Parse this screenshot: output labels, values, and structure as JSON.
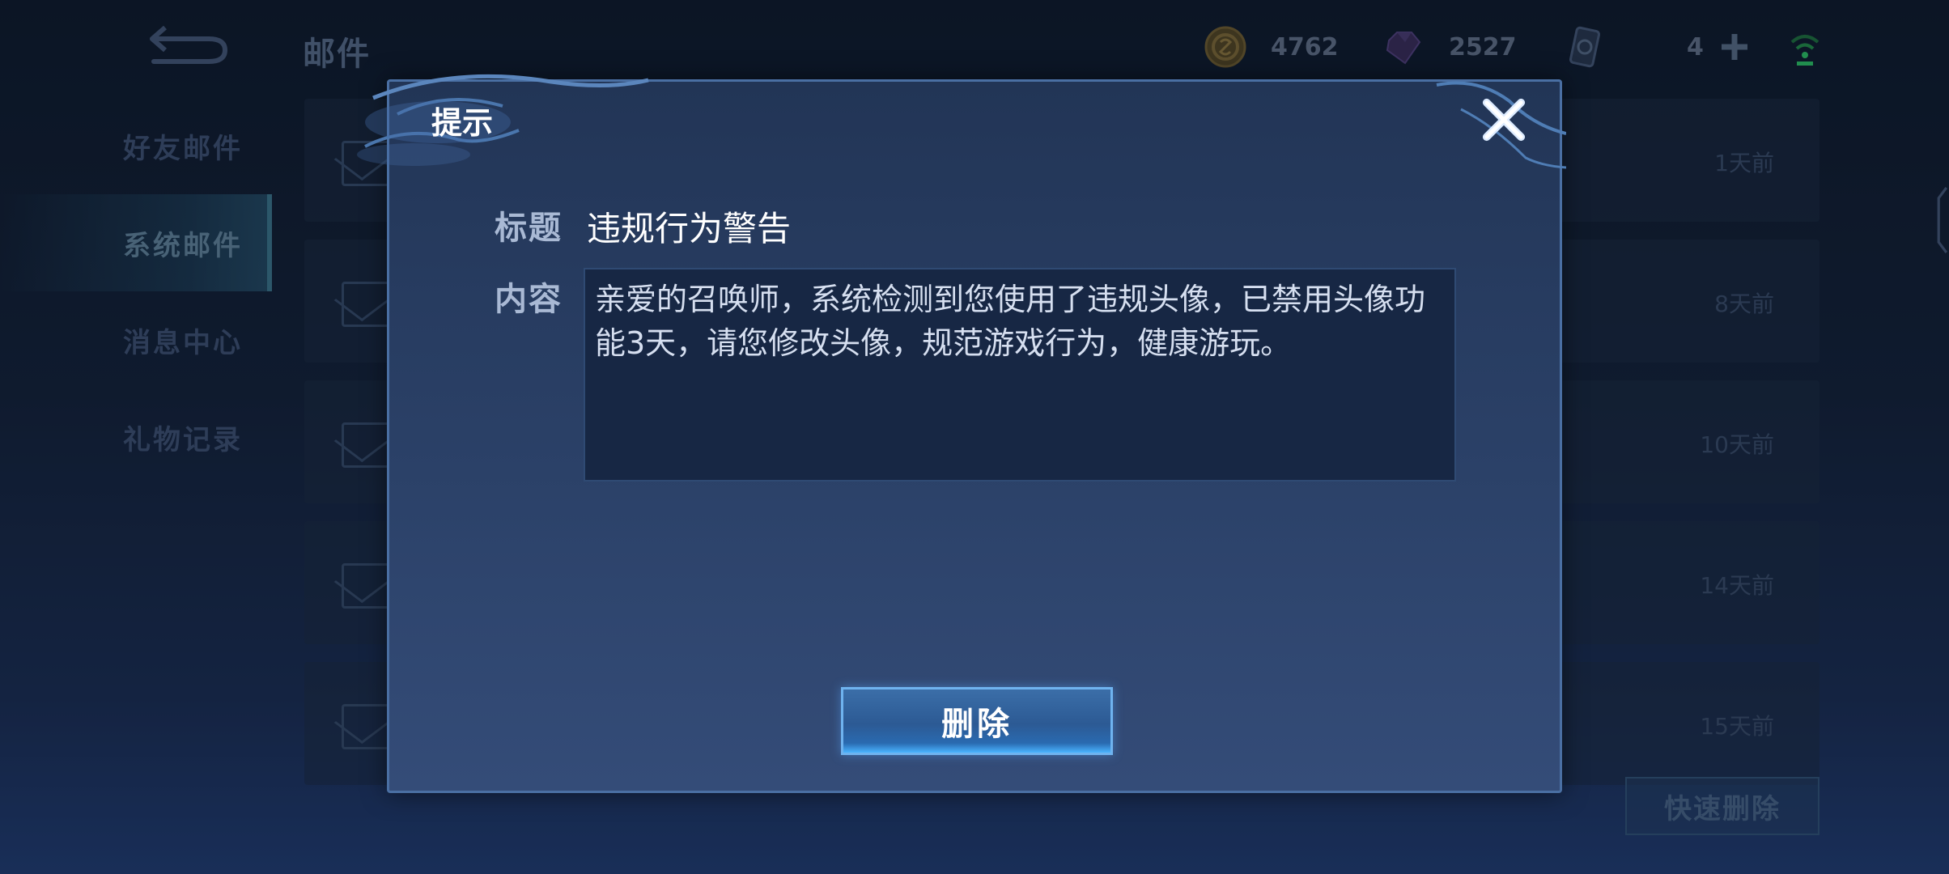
{
  "header": {
    "title": "邮件",
    "currencies": [
      {
        "icon": "gold-coin-icon",
        "value": "4762"
      },
      {
        "icon": "diamond-icon",
        "value": "2527"
      },
      {
        "icon": "ticket-card-icon",
        "value": "4"
      }
    ]
  },
  "sidebar": {
    "items": [
      {
        "label": "好友邮件"
      },
      {
        "label": "系统邮件",
        "active": true
      },
      {
        "label": "消息中心"
      },
      {
        "label": "礼物记录"
      }
    ]
  },
  "mail_list": [
    {
      "time": "1天前"
    },
    {
      "time": "8天前"
    },
    {
      "time": "10天前"
    },
    {
      "time": "14天前"
    },
    {
      "time": "15天前"
    }
  ],
  "quick_delete_label": "快速删除",
  "dialog": {
    "title": "提示",
    "subject_label": "标题",
    "subject": "违规行为警告",
    "content_label": "内容",
    "content": "亲爱的召唤师，系统检测到您使用了违规头像，已禁用头像功能3天，请您修改头像，规范游戏行为，健康游玩。",
    "delete_label": "删除"
  },
  "colors": {
    "dialog_border": "#4a6fa3",
    "button_glow": "#4ab4ff",
    "signal_green": "#2fd36a"
  }
}
